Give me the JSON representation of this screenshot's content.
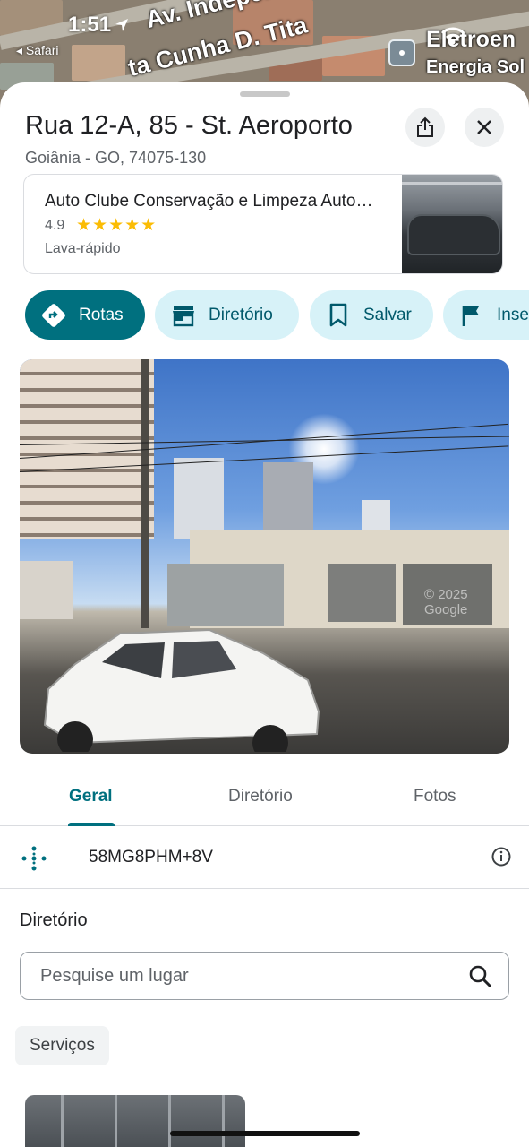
{
  "status_bar": {
    "time": "1:51",
    "back_app": "◂ Safari"
  },
  "map": {
    "street_labels": [
      "Av. Independ",
      "ta Cunha D. Tita"
    ],
    "business_label_line1": "Eletroen",
    "business_label_line2": "Energia Sol"
  },
  "place": {
    "title": "Rua 12-A, 85 - St. Aeroporto",
    "subtitle": "Goiânia - GO, 74075-130"
  },
  "business": {
    "name": "Auto Clube Conservação e Limpeza Auto…",
    "rating": "4.9",
    "stars": "★★★★★",
    "category": "Lava-rápido"
  },
  "actions": [
    {
      "label": "Rotas",
      "icon": "directions-icon"
    },
    {
      "label": "Diretório",
      "icon": "storefront-icon"
    },
    {
      "label": "Salvar",
      "icon": "bookmark-icon"
    },
    {
      "label": "Inse",
      "icon": "flag-icon"
    }
  ],
  "photo": {
    "watermark": "© 2025 Google"
  },
  "tabs": [
    {
      "label": "Geral",
      "active": true
    },
    {
      "label": "Diretório",
      "active": false
    },
    {
      "label": "Fotos",
      "active": false
    }
  ],
  "plus_code": {
    "value": "58MG8PHM+8V"
  },
  "directory": {
    "heading": "Diretório",
    "search_placeholder": "Pesquise um lugar",
    "filter_chip": "Serviços"
  },
  "colors": {
    "accent": "#00707f",
    "chip_bg": "#d7f2f8",
    "chip_text": "#00596b",
    "star": "#fbbc04"
  }
}
